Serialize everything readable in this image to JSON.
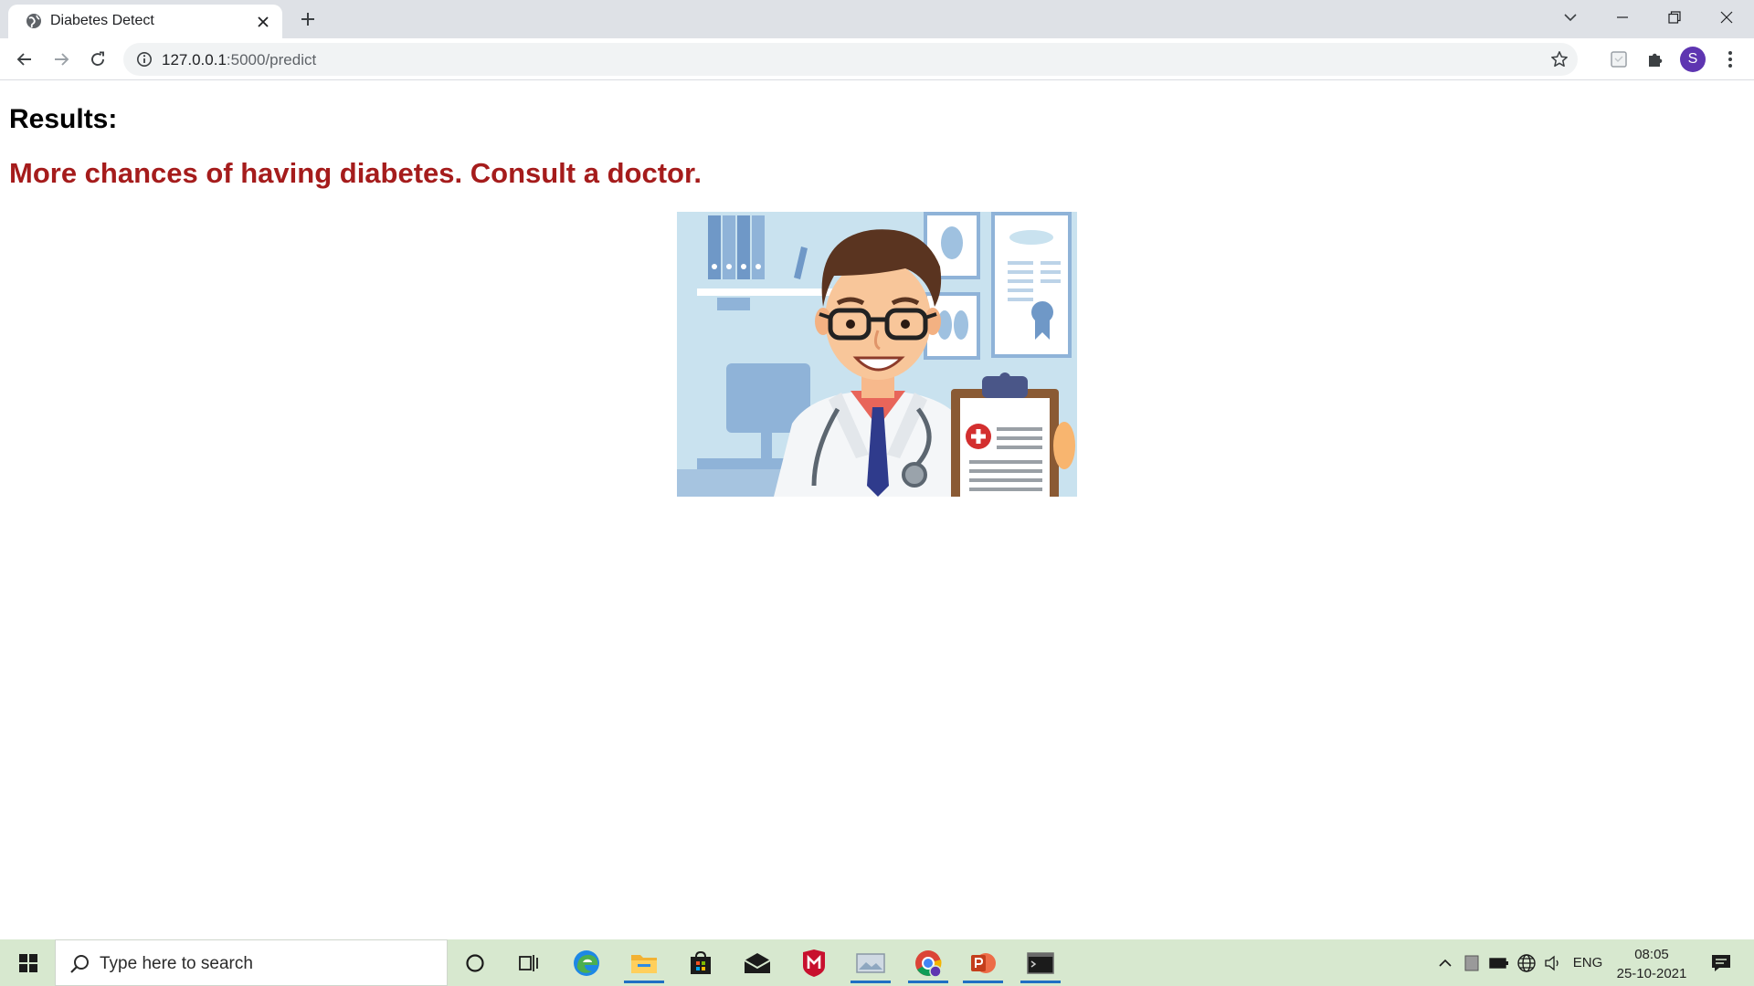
{
  "browser": {
    "tab": {
      "title": "Diabetes Detect",
      "favicon": "globe-icon",
      "close_icon": "close-icon"
    },
    "new_tab_icon": "plus-icon",
    "window_controls": [
      "chevron-down-icon",
      "minimize-icon",
      "restore-icon",
      "close-icon"
    ],
    "address_bar": {
      "host": "127.0.0.1",
      "path": ":5000/predict",
      "info_icon": "info-icon",
      "bookmark_icon": "star-icon"
    },
    "toolbar_icons": [
      "back-icon",
      "forward-icon",
      "reload-icon",
      "extension-box-icon",
      "puzzle-icon",
      "menu-dots-icon"
    ],
    "profile_initial": "S"
  },
  "page": {
    "heading": "Results:",
    "message": "More chances of having diabetes. Consult a doctor.",
    "message_color": "#a51c1c",
    "image_subject": "doctor-illustration"
  },
  "taskbar": {
    "search_placeholder": "Type here to search",
    "apps": [
      "cortana-icon",
      "task-view-icon",
      "edge-icon",
      "file-explorer-icon",
      "store-icon",
      "mail-icon",
      "mcafee-icon",
      "photos-icon",
      "chrome-icon",
      "powerpoint-icon",
      "terminal-icon"
    ],
    "language": "ENG",
    "time": "08:05",
    "date": "25-10-2021",
    "accent_color": "#1f6fc4",
    "background_color": "#d7e8cf"
  }
}
